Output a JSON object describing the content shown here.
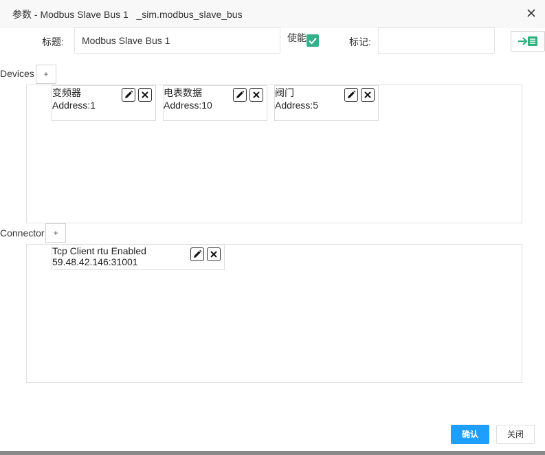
{
  "window": {
    "title": "参数 - Modbus Slave Bus 1   _sim.modbus_slave_bus",
    "close_icon": "close-icon"
  },
  "form": {
    "title_label": "标题:",
    "title_value": "Modbus Slave Bus 1",
    "enable_label": "使能",
    "enabled": true,
    "tag_label": "标记:",
    "tag_value": "",
    "export_icon": "export-icon"
  },
  "devices": {
    "label": "Devices",
    "add_label": "+",
    "items": [
      {
        "name": "变频器",
        "address": "Address:1"
      },
      {
        "name": "电表数据",
        "address": "Address:10"
      },
      {
        "name": "阀门",
        "address": "Address:5"
      }
    ]
  },
  "connector": {
    "label": "Connector",
    "add_label": "+",
    "items": [
      {
        "name": "Tcp Client rtu Enabled",
        "address": "59.48.42.146:31001"
      }
    ]
  },
  "footer": {
    "ok_label": "确认",
    "close_label": "关闭"
  },
  "colors": {
    "primary": "#1e9fff",
    "check_green": "#33b18a",
    "export_green": "#2db17e"
  }
}
